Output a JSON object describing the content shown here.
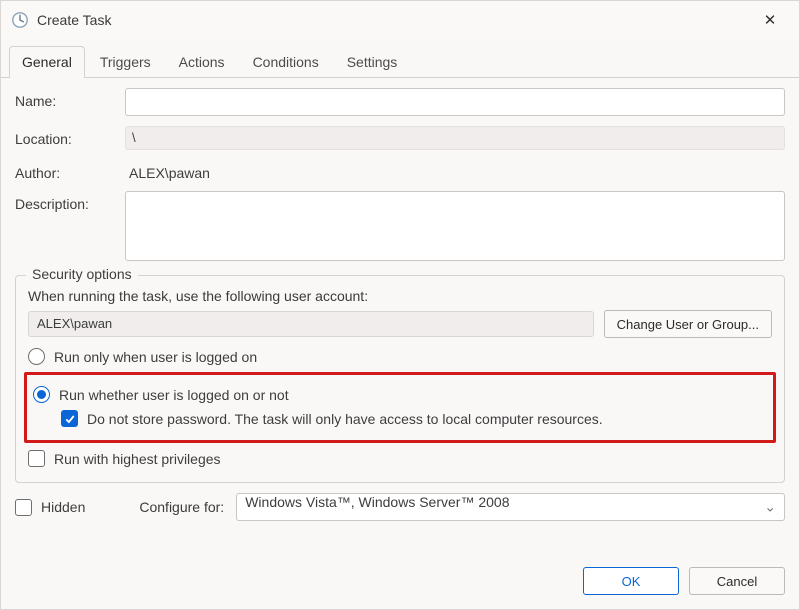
{
  "window": {
    "title": "Create Task"
  },
  "tabs": [
    {
      "label": "General",
      "active": true
    },
    {
      "label": "Triggers",
      "active": false
    },
    {
      "label": "Actions",
      "active": false
    },
    {
      "label": "Conditions",
      "active": false
    },
    {
      "label": "Settings",
      "active": false
    }
  ],
  "fields": {
    "name_label": "Name:",
    "name_value": "",
    "location_label": "Location:",
    "location_value": "\\",
    "author_label": "Author:",
    "author_value": "ALEX\\pawan",
    "description_label": "Description:",
    "description_value": ""
  },
  "security": {
    "legend": "Security options",
    "prompt": "When running the task, use the following user account:",
    "account": "ALEX\\pawan",
    "change_button": "Change User or Group...",
    "radio_logged_on": "Run only when user is logged on",
    "radio_whether": "Run whether user is logged on or not",
    "dont_store_pw": "Do not store password.  The task will only have access to local computer resources.",
    "highest_priv": "Run with highest privileges"
  },
  "bottom": {
    "hidden_label": "Hidden",
    "configure_label": "Configure for:",
    "configure_value": "Windows Vista™, Windows Server™ 2008"
  },
  "buttons": {
    "ok": "OK",
    "cancel": "Cancel"
  }
}
